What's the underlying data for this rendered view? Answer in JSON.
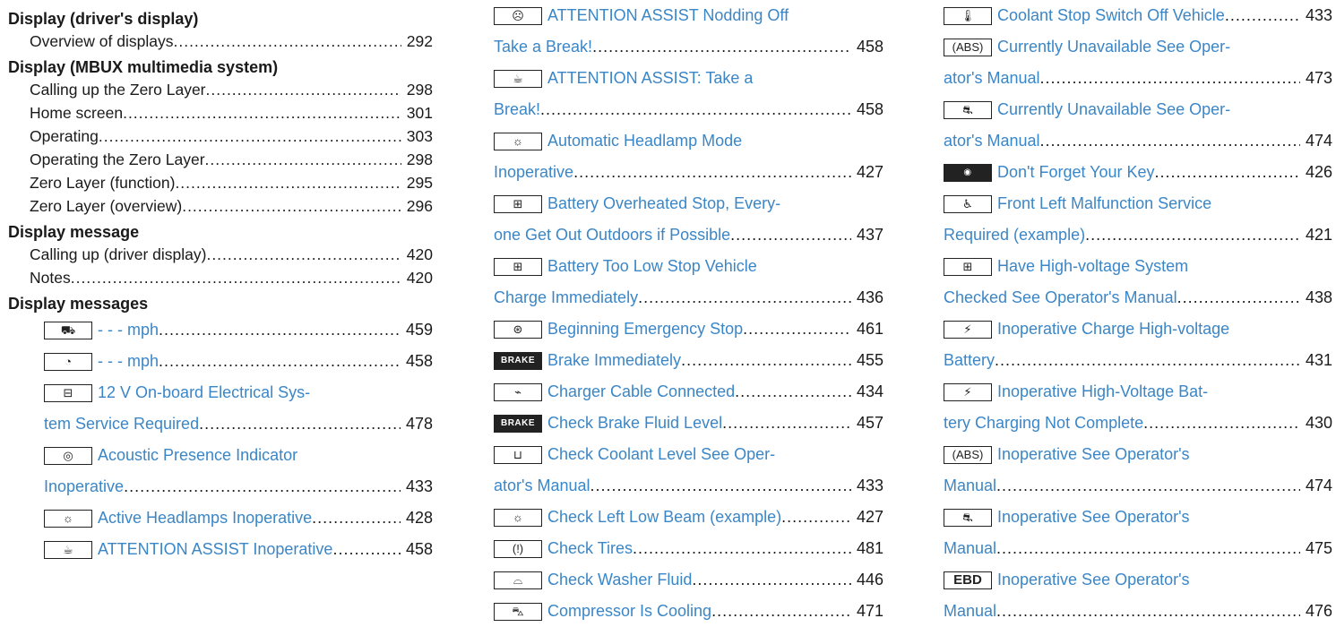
{
  "col1": {
    "h_driver": "Display (driver's display)",
    "driver_items": [
      {
        "label": "Overview of displays",
        "page": "292"
      }
    ],
    "h_mbux": "Display (MBUX multimedia system)",
    "mbux_items": [
      {
        "label": "Calling up the Zero Layer",
        "page": "298"
      },
      {
        "label": "Home screen",
        "page": "301"
      },
      {
        "label": "Operating",
        "page": "303"
      },
      {
        "label": "Operating the Zero Layer",
        "page": "298"
      },
      {
        "label": "Zero Layer (function)",
        "page": "295"
      },
      {
        "label": "Zero Layer (overview)",
        "page": "296"
      }
    ],
    "h_message": "Display message",
    "message_items": [
      {
        "label": "Calling up (driver display)",
        "page": "420"
      },
      {
        "label": "Notes",
        "page": "420"
      }
    ],
    "h_messages": "Display messages",
    "msg_lines": [
      {
        "icon": "distance-gauge-icon",
        "glyph": "⛟",
        "text": "- - - mph",
        "page": "459"
      },
      {
        "icon": "speed-gauge-icon",
        "glyph": "◔",
        "text": "- - - mph",
        "page": "458"
      },
      {
        "icon": "battery-icon",
        "glyph": "⊟",
        "text": "12 V On-board Electrical Sys-",
        "page": ""
      },
      {
        "icon": "",
        "glyph": "",
        "text": "tem Service Required",
        "page": "478"
      },
      {
        "icon": "presence-off-icon",
        "glyph": "◎",
        "text": "Acoustic Presence Indicator",
        "page": ""
      },
      {
        "icon": "",
        "glyph": "",
        "text": "Inoperative",
        "page": "433"
      },
      {
        "icon": "headlamp-icon",
        "glyph": "☼",
        "text": "Active Headlamps Inoperative",
        "page": "428"
      },
      {
        "icon": "coffee-cup-icon",
        "glyph": "☕",
        "text": "ATTENTION ASSIST Inoperative",
        "page": "458"
      }
    ]
  },
  "col2": {
    "lines": [
      {
        "icon": "drowsy-icon",
        "glyph": "☹",
        "text": "ATTENTION ASSIST Nodding Off",
        "page": ""
      },
      {
        "icon": "",
        "glyph": "",
        "text": "Take a Break!",
        "page": "458"
      },
      {
        "icon": "coffee-cup-icon",
        "glyph": "☕",
        "text": "ATTENTION ASSIST: Take a",
        "page": ""
      },
      {
        "icon": "",
        "glyph": "",
        "text": "Break!",
        "page": "458"
      },
      {
        "icon": "headlamp-icon",
        "glyph": "☼",
        "text": "Automatic Headlamp Mode",
        "page": ""
      },
      {
        "icon": "",
        "glyph": "",
        "text": "Inoperative",
        "page": "427"
      },
      {
        "icon": "hv-battery-icon",
        "glyph": "⊞",
        "text": "Battery Overheated Stop, Every-",
        "page": ""
      },
      {
        "icon": "",
        "glyph": "",
        "text": "one Get Out Outdoors if Possible",
        "page": "437"
      },
      {
        "icon": "hv-battery-icon",
        "glyph": "⊞",
        "text": "Battery Too Low Stop Vehicle",
        "page": ""
      },
      {
        "icon": "",
        "glyph": "",
        "text": "Charge Immediately",
        "page": "436"
      },
      {
        "icon": "steering-wheel-icon",
        "glyph": "⊛",
        "text": "Beginning Emergency Stop",
        "page": "461"
      },
      {
        "icon": "brake-icon",
        "glyph": "BRAKE",
        "text": "Brake Immediately",
        "page": "455",
        "dark": true
      },
      {
        "icon": "charger-plug-icon",
        "glyph": "⌁",
        "text": "Charger Cable Connected",
        "page": "434"
      },
      {
        "icon": "brake-icon",
        "glyph": "BRAKE",
        "text": "Check Brake Fluid Level",
        "page": "457",
        "dark": true
      },
      {
        "icon": "coolant-icon",
        "glyph": "⊔",
        "text": "Check Coolant Level See Oper-",
        "page": ""
      },
      {
        "icon": "",
        "glyph": "",
        "text": "ator's Manual",
        "page": "433"
      },
      {
        "icon": "headlamp-icon",
        "glyph": "☼",
        "text": "Check Left Low Beam (example)",
        "page": "427"
      },
      {
        "icon": "tire-pressure-icon",
        "glyph": "(!)",
        "text": "Check Tires",
        "page": "481"
      },
      {
        "icon": "washer-fluid-icon",
        "glyph": "⌓",
        "text": "Check Washer Fluid",
        "page": "446"
      },
      {
        "icon": "car-compressor-icon",
        "glyph": "⛍",
        "text": "Compressor Is Cooling",
        "page": "471"
      }
    ]
  },
  "col3": {
    "lines": [
      {
        "icon": "coolant-temp-icon",
        "glyph": "🌡",
        "text": "Coolant Stop Switch Off Vehicle",
        "page": "433"
      },
      {
        "icon": "abs-icon",
        "glyph": "(ABS)",
        "text": "Currently Unavailable See Oper-",
        "page": ""
      },
      {
        "icon": "",
        "glyph": "",
        "text": "ator's Manual",
        "page": "473"
      },
      {
        "icon": "esp-icon",
        "glyph": "⛐",
        "text": "Currently Unavailable See Oper-",
        "page": ""
      },
      {
        "icon": "",
        "glyph": "",
        "text": "ator's Manual",
        "page": "474"
      },
      {
        "icon": "key-icon",
        "glyph": "◉",
        "text": "Don't Forget Your Key",
        "page": "426",
        "dark": true
      },
      {
        "icon": "airbag-icon",
        "glyph": "♿",
        "text": "Front Left Malfunction Service",
        "page": ""
      },
      {
        "icon": "",
        "glyph": "",
        "text": "Required (example)",
        "page": "421"
      },
      {
        "icon": "hv-battery-icon",
        "glyph": "⊞",
        "text": "Have High-voltage System",
        "page": ""
      },
      {
        "icon": "",
        "glyph": "",
        "text": "Checked See Operator's Manual",
        "page": "438"
      },
      {
        "icon": "hv-charge-icon",
        "glyph": "⚡",
        "text": "Inoperative Charge High-voltage",
        "page": ""
      },
      {
        "icon": "",
        "glyph": "",
        "text": "Battery",
        "page": "431"
      },
      {
        "icon": "hv-charge-icon",
        "glyph": "⚡",
        "text": "Inoperative High-Voltage Bat-",
        "page": ""
      },
      {
        "icon": "",
        "glyph": "",
        "text": "tery Charging Not Complete",
        "page": "430"
      },
      {
        "icon": "abs-icon",
        "glyph": "(ABS)",
        "text": "Inoperative See Operator's",
        "page": ""
      },
      {
        "icon": "",
        "glyph": "",
        "text": "Manual",
        "page": "474"
      },
      {
        "icon": "esp-icon",
        "glyph": "⛐",
        "text": "Inoperative See Operator's",
        "page": ""
      },
      {
        "icon": "",
        "glyph": "",
        "text": "Manual",
        "page": "475"
      },
      {
        "icon": "ebd-icon",
        "glyph": "EBD",
        "text": "Inoperative See Operator's",
        "page": ""
      },
      {
        "icon": "",
        "glyph": "",
        "text": "Manual",
        "page": "476"
      }
    ]
  }
}
